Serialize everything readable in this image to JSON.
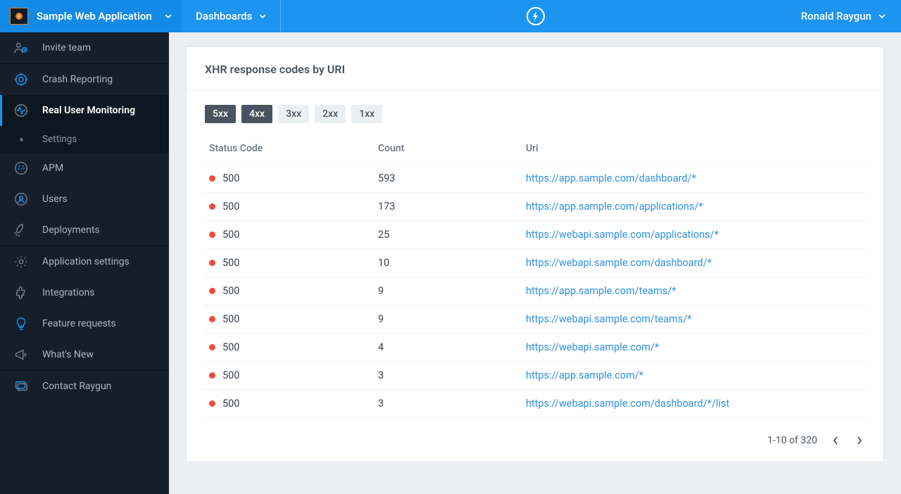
{
  "topbar": {
    "app_name": "Sample Web Application",
    "section": "Dashboards",
    "user": "Ronald Raygun"
  },
  "sidebar": {
    "invite": "Invite team",
    "crash": "Crash Reporting",
    "rum": "Real User Monitoring",
    "rum_sub_settings": "Settings",
    "apm": "APM",
    "users": "Users",
    "deployments": "Deployments",
    "app_settings": "Application settings",
    "integrations": "Integrations",
    "feature_requests": "Feature requests",
    "whats_new": "What's New",
    "contact": "Contact Raygun"
  },
  "card": {
    "title": "XHR response codes by URI",
    "pills": {
      "p5": "5xx",
      "p4": "4xx",
      "p3": "3xx",
      "p2": "2xx",
      "p1": "1xx"
    },
    "headers": {
      "status": "Status Code",
      "count": "Count",
      "uri": "Uri"
    },
    "rows": [
      {
        "status": "500",
        "count": "593",
        "uri": "https://app.sample.com/dashboard/*"
      },
      {
        "status": "500",
        "count": "173",
        "uri": "https://app.sample.com/applications/*"
      },
      {
        "status": "500",
        "count": "25",
        "uri": "https://webapi.sample.com/applications/*"
      },
      {
        "status": "500",
        "count": "10",
        "uri": "https://webapi.sample.com/dashboard/*"
      },
      {
        "status": "500",
        "count": "9",
        "uri": "https://app.sample.com/teams/*"
      },
      {
        "status": "500",
        "count": "9",
        "uri": "https://webapi.sample.com/teams/*"
      },
      {
        "status": "500",
        "count": "4",
        "uri": "https://webapi.sample.com/*"
      },
      {
        "status": "500",
        "count": "3",
        "uri": "https://app.sample.com/*"
      },
      {
        "status": "500",
        "count": "3",
        "uri": "https://webapi.sample.com/dashboard/*/list"
      }
    ],
    "pager": "1-10 of 320"
  },
  "colors": {
    "status_dot": "#ef4b3c",
    "accent": "#1d95f0",
    "link": "#2f90e3"
  }
}
